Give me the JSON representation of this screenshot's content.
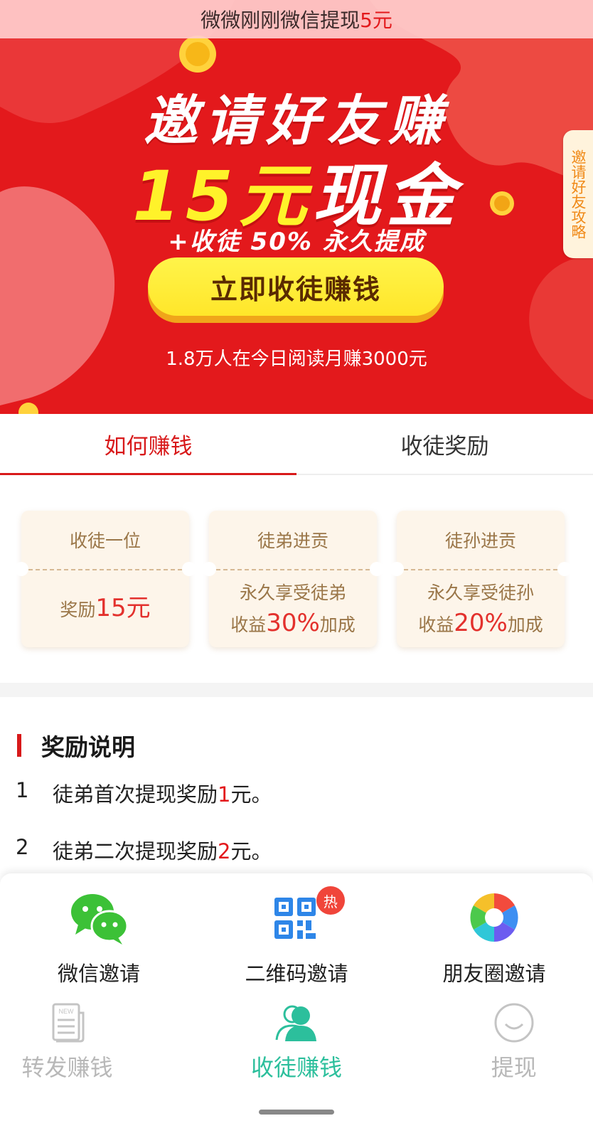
{
  "ticker": {
    "text": "微微刚刚微信提现",
    "amount": "5元"
  },
  "hero": {
    "title_line1": "邀请好友赚",
    "title_amount": "15元",
    "title_cash": "现金",
    "subtitle": "+收徒 50% 永久提成",
    "cta_label": "立即收徒赚钱",
    "stat_text": "1.8万人在今日阅读月赚3000元",
    "strategy_label": "邀请好友攻略"
  },
  "tabs": [
    {
      "label": "如何赚钱",
      "active": true
    },
    {
      "label": "收徒奖励",
      "active": false
    }
  ],
  "cards": [
    {
      "head": "收徒一位",
      "line1_pre": "奖励",
      "line1_big": "15元",
      "line1_post": "",
      "line2_pre": "",
      "line2_big": "",
      "line2_post": ""
    },
    {
      "head": "徒弟进贡",
      "line1_pre": "永久享受徒弟",
      "line1_big": "",
      "line1_post": "",
      "line2_pre": "收益",
      "line2_big": "30%",
      "line2_post": "加成"
    },
    {
      "head": "徒孙进贡",
      "line1_pre": "永久享受徒孙",
      "line1_big": "",
      "line1_post": "",
      "line2_pre": "收益",
      "line2_big": "20%",
      "line2_post": "加成"
    }
  ],
  "rules": {
    "title": "奖励说明",
    "items": [
      {
        "num": "1",
        "pre": "徒弟首次提现奖励",
        "hl": "1",
        "post": "元。"
      },
      {
        "num": "2",
        "pre": "徒弟二次提现奖励",
        "hl": "2",
        "post": "元。"
      }
    ]
  },
  "share": [
    {
      "label": "微信邀请",
      "icon": "wechat-icon"
    },
    {
      "label": "二维码邀请",
      "icon": "qrcode-icon",
      "badge": "热"
    },
    {
      "label": "朋友圈邀请",
      "icon": "moments-icon"
    }
  ],
  "nav": [
    {
      "label": "转发赚钱",
      "icon": "news-icon",
      "active": false
    },
    {
      "label": "收徒赚钱",
      "icon": "user-group-icon",
      "active": true
    },
    {
      "label": "提现",
      "icon": "smile-icon",
      "active": false
    }
  ],
  "colors": {
    "brand_red": "#e3191c",
    "accent_yellow": "#fff22a",
    "nav_active": "#2cbf9c"
  }
}
